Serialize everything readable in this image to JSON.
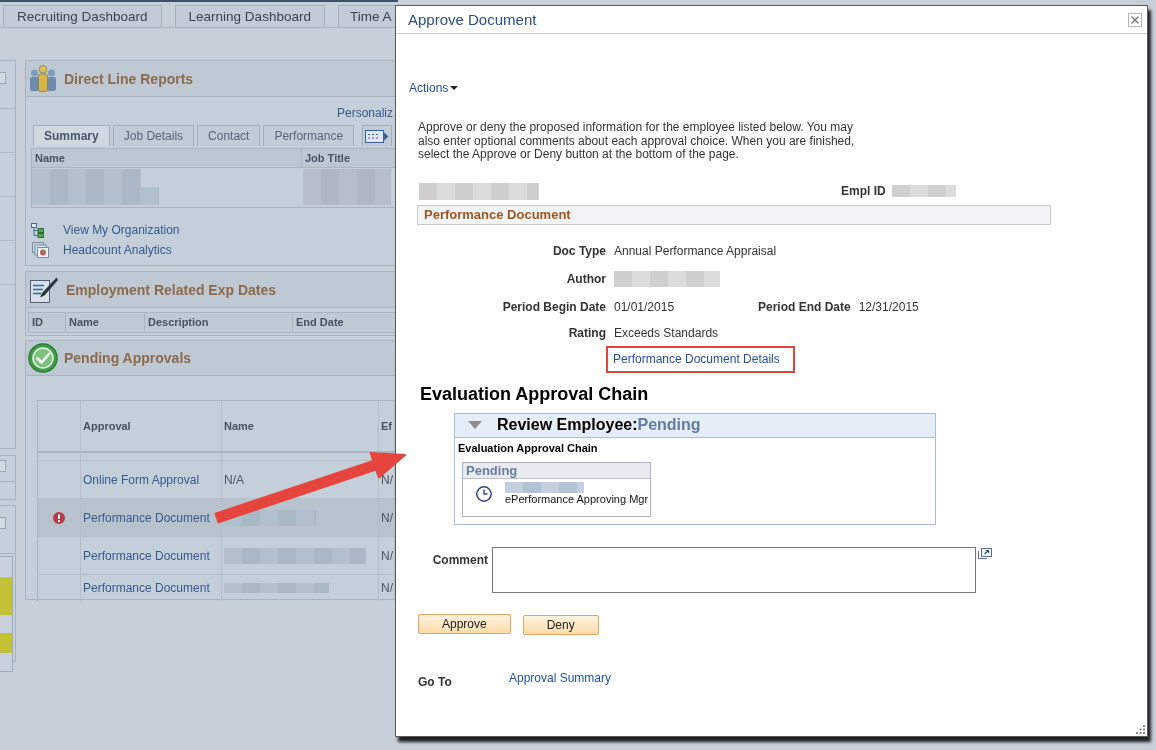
{
  "top_tabs": [
    {
      "label": "Recruiting Dashboard",
      "selected": false
    },
    {
      "label": "Learning Dashboard",
      "selected": false
    },
    {
      "label": "Time A",
      "selected": false
    }
  ],
  "direct_line_reports": {
    "title": "Direct Line Reports",
    "personalize_link": "Personaliz",
    "tabs": [
      {
        "label": "Summary",
        "selected": true
      },
      {
        "label": "Job Details",
        "selected": false
      },
      {
        "label": "Contact",
        "selected": false
      },
      {
        "label": "Performance",
        "selected": false
      }
    ],
    "columns": [
      "Name",
      "Job Title"
    ],
    "links": [
      "View My Organization",
      "Headcount Analytics"
    ]
  },
  "employment_exp_dates": {
    "title": "Employment Related Exp Dates",
    "columns": [
      "ID",
      "Name",
      "Description",
      "End Date"
    ]
  },
  "pending_approvals": {
    "title": "Pending Approvals",
    "columns": [
      "Approval",
      "Name",
      "Ef"
    ],
    "rows": [
      {
        "approval": "Online Form Approval",
        "name": "N/A",
        "column_3": "N/",
        "alert": false,
        "selected": false
      },
      {
        "approval": "Performance Document",
        "column_3": "N/",
        "alert": true,
        "selected": true
      },
      {
        "approval": "Performance Document",
        "column_3": "N/",
        "alert": false,
        "selected": false
      },
      {
        "approval": "Performance Document",
        "column_3": "N/",
        "alert": false,
        "selected": false
      }
    ]
  },
  "dialog": {
    "title": "Approve Document",
    "actions_menu": "Actions",
    "instructions": "Approve or deny the proposed information for the employee listed below. You may also enter optional comments about each approval choice. When you are finished, select the Approve or Deny button at the bottom of the page.",
    "empl_id_label": "Empl ID",
    "section_title": "Performance Document",
    "fields": [
      {
        "label": "Doc Type",
        "value": "Annual Performance Appraisal"
      },
      {
        "label": "Author"
      },
      {
        "label": "Period Begin Date",
        "value": "01/01/2015",
        "second_label": "Period End Date",
        "second_value": "12/31/2015"
      },
      {
        "label": "Rating",
        "value": "Exceeds Standards"
      }
    ],
    "details_link": {
      "label": "Performance Document Details",
      "highlighted": true
    },
    "chain": {
      "heading": "Evaluation Approval Chain",
      "stage_label": "Review Employee:",
      "stage_status": "Pending",
      "expanded": true,
      "subheading": "Evaluation Approval Chain",
      "step_status": "Pending",
      "step_role": "ePerformance Approving Mgr"
    },
    "comment_label": "Comment",
    "buttons": [
      "Approve",
      "Deny"
    ],
    "goto_label": "Go To",
    "goto_link": "Approval Summary"
  }
}
